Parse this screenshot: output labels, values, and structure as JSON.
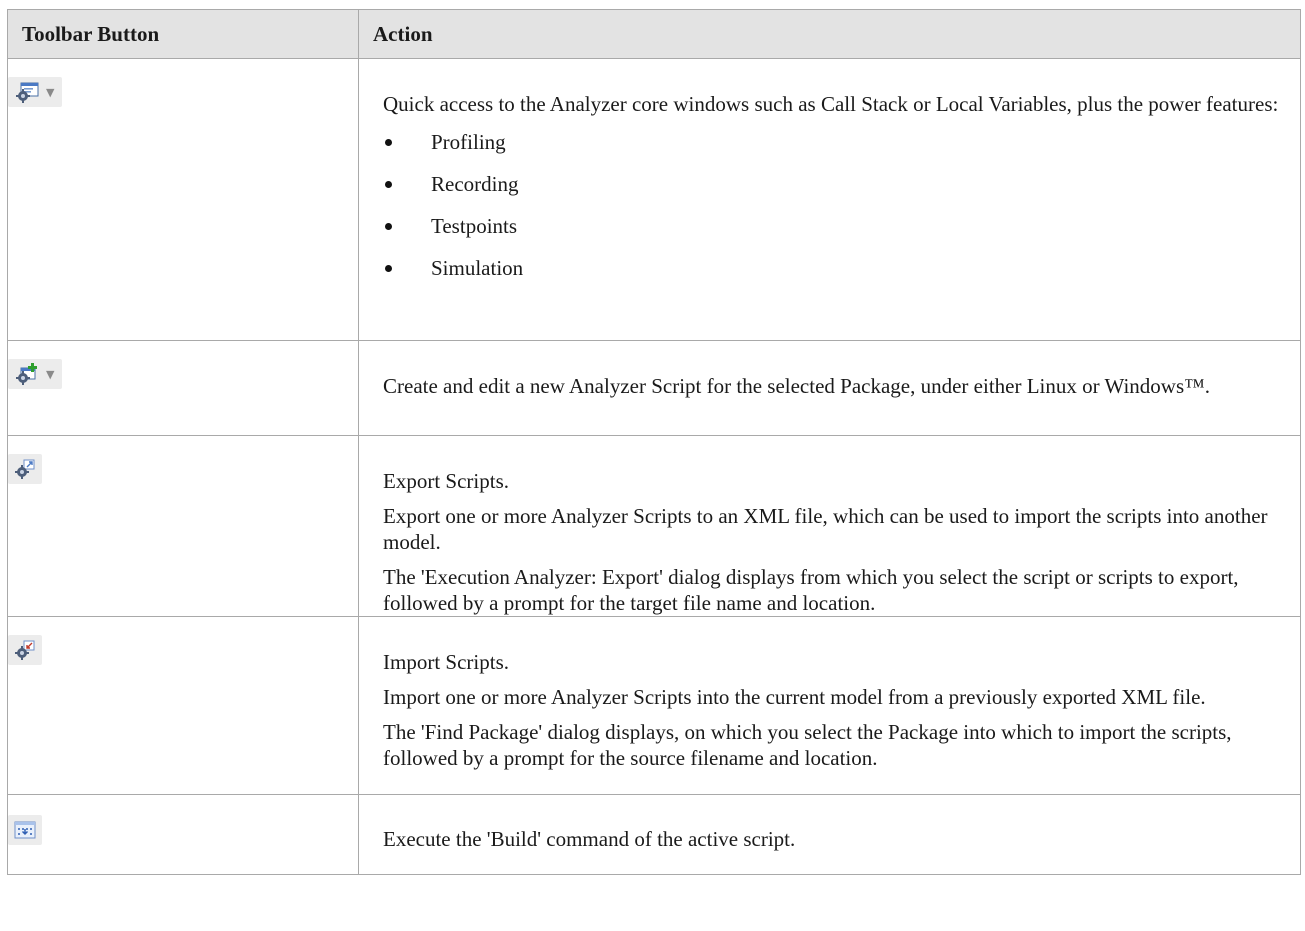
{
  "table": {
    "headers": {
      "col1": "Toolbar Button",
      "col2": "Action"
    },
    "rows": [
      {
        "icon": "analyzer-windows-icon",
        "has_dropdown": true,
        "paragraphs": [
          "Quick access to the Analyzer core windows such as Call Stack or Local Variables, plus the power features:"
        ],
        "bullets": [
          "Profiling",
          "Recording",
          "Testpoints",
          "Simulation"
        ]
      },
      {
        "icon": "new-script-icon",
        "has_dropdown": true,
        "paragraphs": [
          "Create and edit a new Analyzer Script for the selected Package, under either Linux or Windows™."
        ]
      },
      {
        "icon": "export-scripts-icon",
        "has_dropdown": false,
        "paragraphs": [
          "Export Scripts.",
          "Export one or more Analyzer Scripts to an XML file, which can be used to import the scripts into another model.",
          "The 'Execution Analyzer: Export' dialog displays from which you select the script or scripts to export, followed by a prompt for the target file name and location."
        ]
      },
      {
        "icon": "import-scripts-icon",
        "has_dropdown": false,
        "paragraphs": [
          "Import Scripts.",
          "Import one or more Analyzer Scripts into the current model from a previously exported XML file.",
          "The 'Find Package' dialog displays, on which you select the Package into which to import the scripts, followed by a prompt for the source filename and location."
        ]
      },
      {
        "icon": "build-icon",
        "has_dropdown": false,
        "paragraphs": [
          "Execute the 'Build' command of the active script."
        ]
      }
    ]
  }
}
